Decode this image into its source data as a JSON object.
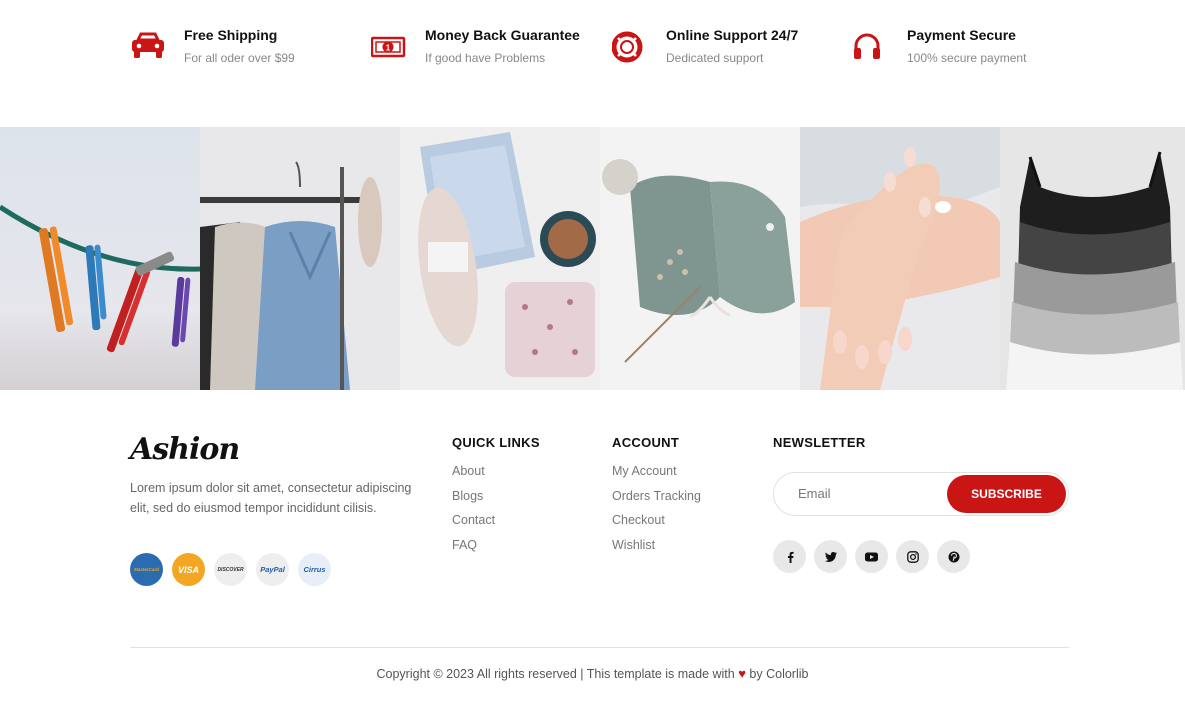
{
  "services": [
    {
      "title": "Free Shipping",
      "subtitle": "For all oder over $99",
      "icon": "car-icon"
    },
    {
      "title": "Money Back Guarantee",
      "subtitle": "If good have Problems",
      "icon": "money-icon"
    },
    {
      "title": "Online Support 24/7",
      "subtitle": "Dedicated support",
      "icon": "support-icon"
    },
    {
      "title": "Payment Secure",
      "subtitle": "100% secure payment",
      "icon": "headphones-icon"
    }
  ],
  "instagram": {
    "tiles": [
      "clothespins-photo",
      "clothes-rack-photo",
      "yarn-flatlay-photo",
      "knit-bonnet-photo",
      "hand-cream-photo",
      "camisoles-photo"
    ]
  },
  "footer": {
    "logo": "Ashion",
    "about": "Lorem ipsum dolor sit amet, consectetur adipiscing elit, sed do eiusmod tempor incididunt cilisis.",
    "payments": [
      {
        "label": "MasterCard",
        "icon": "mastercard-icon",
        "bg": "#2b6cb0",
        "fg": "#f4a31b"
      },
      {
        "label": "VISA",
        "icon": "visa-icon",
        "bg": "#f2a623",
        "fg": "#ffffff"
      },
      {
        "label": "DISCOVER",
        "icon": "discover-icon",
        "bg": "#eeeeee",
        "fg": "#333333"
      },
      {
        "label": "PayPal",
        "icon": "paypal-icon",
        "bg": "#eeeeee",
        "fg": "#1f5fa8"
      },
      {
        "label": "Cirrus",
        "icon": "cirrus-icon",
        "bg": "#e8eef7",
        "fg": "#1f5fa8"
      }
    ],
    "quick_links": {
      "title": "QUICK LINKS",
      "items": [
        "About",
        "Blogs",
        "Contact",
        "FAQ"
      ]
    },
    "account": {
      "title": "ACCOUNT",
      "items": [
        "My Account",
        "Orders Tracking",
        "Checkout",
        "Wishlist"
      ]
    },
    "newsletter": {
      "title": "NEWSLETTER",
      "placeholder": "Email",
      "button": "SUBSCRIBE"
    },
    "socials": [
      "facebook-icon",
      "twitter-icon",
      "youtube-icon",
      "instagram-icon",
      "pinterest-icon"
    ],
    "copyright_prefix": "Copyright © 2023 All rights reserved | This template is made with",
    "copyright_heart": "♥",
    "copyright_suffix": "by Colorlib"
  },
  "colors": {
    "accent": "#ca1515",
    "muted": "#888888"
  }
}
